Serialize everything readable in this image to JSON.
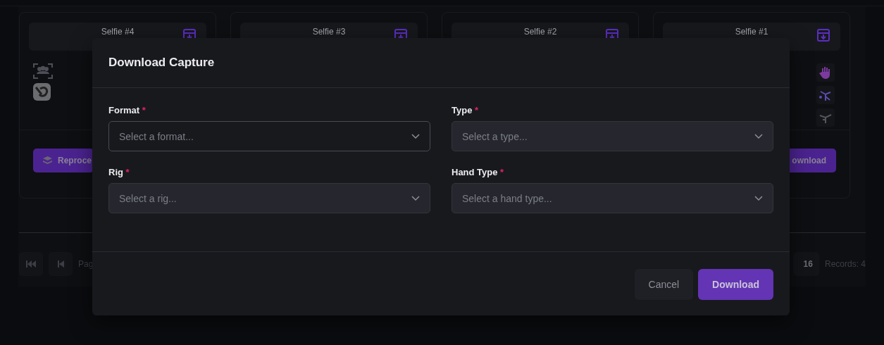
{
  "cards": [
    {
      "title": "Selfie #4",
      "action_label": "Reproce",
      "kind": "left"
    },
    {
      "title": "Selfie #3"
    },
    {
      "title": "Selfie #2"
    },
    {
      "title": "Selfie #1",
      "action_label": "ownload",
      "kind": "right"
    }
  ],
  "pagination": {
    "page_label": "Pag",
    "page_count": "16",
    "records": "Records: 4"
  },
  "modal": {
    "title": "Download Capture",
    "fields": [
      {
        "label": "Format",
        "required_mark": "*",
        "placeholder": "Select a format...",
        "focused": true
      },
      {
        "label": "Type",
        "required_mark": "*",
        "placeholder": "Select a type...",
        "focused": false
      },
      {
        "label": "Rig",
        "required_mark": "*",
        "placeholder": "Select a rig...",
        "focused": false
      },
      {
        "label": "Hand Type",
        "required_mark": "*",
        "placeholder": "Select a hand type...",
        "focused": false
      }
    ],
    "buttons": [
      {
        "label": "Cancel",
        "kind": "secondary"
      },
      {
        "label": "Download",
        "kind": "primary"
      }
    ]
  }
}
